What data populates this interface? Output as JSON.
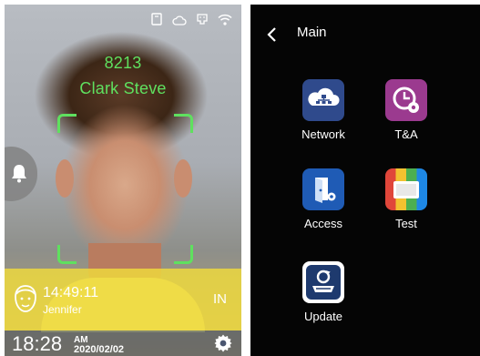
{
  "left_screen": {
    "user_id": "8213",
    "user_name": "Clark Steve",
    "status_icons": [
      "card-icon",
      "cloud-icon",
      "ethernet-icon",
      "wifi-icon"
    ],
    "last_record": {
      "time": "14:49:11",
      "name": "Jennifer",
      "direction": "IN"
    },
    "clock": {
      "time": "18:28",
      "ampm": "AM",
      "date": "2020/02/02"
    },
    "colors": {
      "face_frame": "#5fe05f",
      "record_bar": "#f0dc3c"
    }
  },
  "right_screen": {
    "title": "Main",
    "menu_items": [
      {
        "label": "Network",
        "icon": "network-icon",
        "color": "#2f4a8c"
      },
      {
        "label": "T&A",
        "icon": "time-attendance-icon",
        "color": "#9b3a8f"
      },
      {
        "label": "Access",
        "icon": "access-door-icon",
        "color": "#1f5bb5"
      },
      {
        "label": "Test",
        "icon": "test-icon",
        "color": "#e0463a"
      },
      {
        "label": "Update",
        "icon": "update-icon",
        "color": "#ffffff"
      }
    ]
  }
}
